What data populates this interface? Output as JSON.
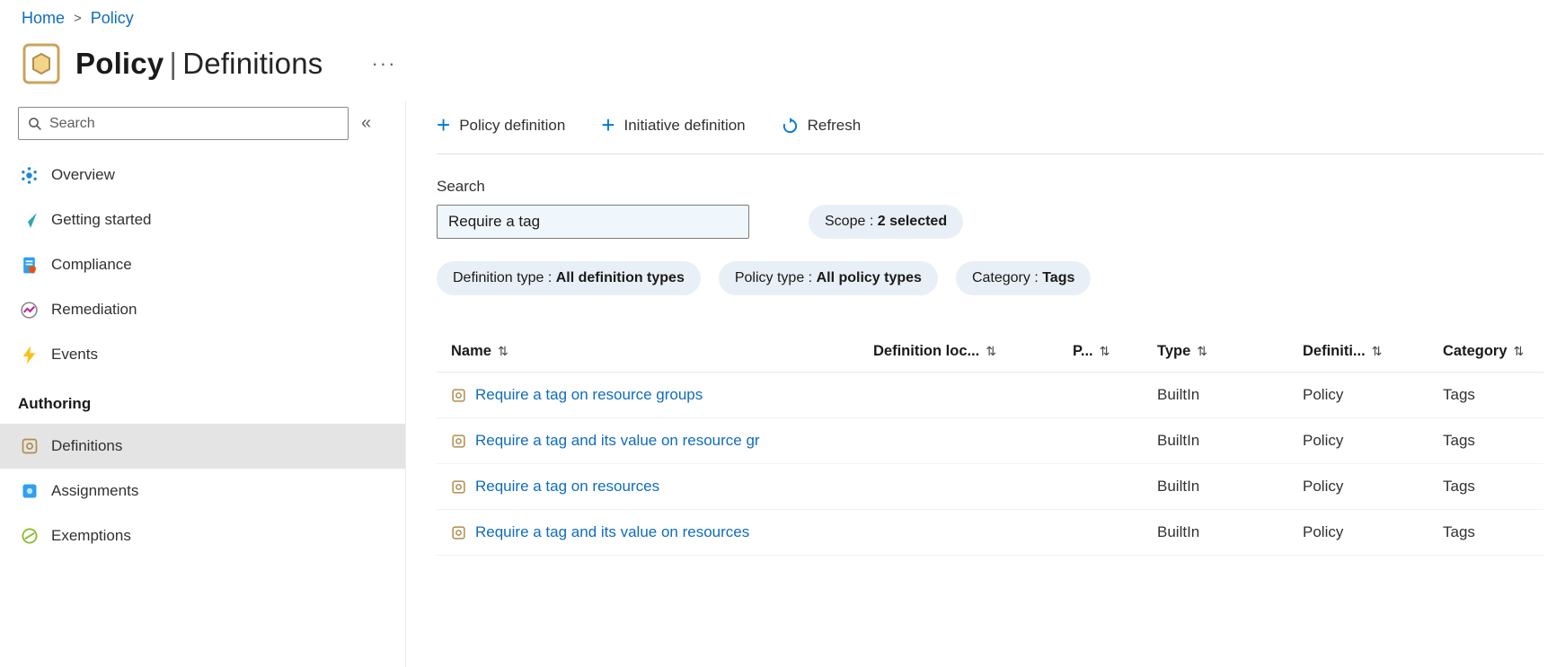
{
  "colors": {
    "accent_blue": "#0078d4",
    "link_blue": "#0f6cbd",
    "pill_background": "#e9eff7",
    "selected_item_background": "#e4e4e4",
    "policy_icon_gold": "#b08d4f"
  },
  "breadcrumb": {
    "separator": ">",
    "items": [
      {
        "label": "Home"
      },
      {
        "label": "Policy"
      }
    ]
  },
  "header": {
    "title_bold": "Policy",
    "title_separator": "|",
    "title_rest": "Definitions",
    "more_label": "···",
    "icon": "policy-page-icon"
  },
  "sidebar": {
    "search": {
      "placeholder": "Search",
      "icon": "search-icon"
    },
    "collapse_icon": "«",
    "items": [
      {
        "label": "Overview",
        "icon": "overview-icon"
      },
      {
        "label": "Getting started",
        "icon": "getting-started-icon"
      },
      {
        "label": "Compliance",
        "icon": "compliance-icon"
      },
      {
        "label": "Remediation",
        "icon": "remediation-icon"
      },
      {
        "label": "Events",
        "icon": "events-icon"
      }
    ],
    "section_label": "Authoring",
    "authoring_items": [
      {
        "label": "Definitions",
        "icon": "definitions-icon",
        "selected": true
      },
      {
        "label": "Assignments",
        "icon": "assignments-icon",
        "selected": false
      },
      {
        "label": "Exemptions",
        "icon": "exemptions-icon",
        "selected": false
      }
    ]
  },
  "command_bar": {
    "policy_definition_label": "Policy definition",
    "initiative_definition_label": "Initiative definition",
    "refresh_label": "Refresh",
    "add_icon": "+",
    "refresh_icon": "refresh-icon"
  },
  "filters": {
    "search_label": "Search",
    "search_value": "Require a tag",
    "pill_separator": " : ",
    "pills": [
      {
        "name": "Scope",
        "value": "2 selected"
      },
      {
        "name": "Definition type",
        "value": "All definition types"
      },
      {
        "name": "Policy type",
        "value": "All policy types"
      },
      {
        "name": "Category",
        "value": "Tags"
      }
    ]
  },
  "table": {
    "sort_icon": "⇅",
    "columns": [
      {
        "label": "Name"
      },
      {
        "label": "Definition loc..."
      },
      {
        "label": "P..."
      },
      {
        "label": "Type"
      },
      {
        "label": "Definiti..."
      },
      {
        "label": "Category"
      }
    ],
    "rows": [
      {
        "name": "Require a tag on resource groups",
        "definition_location": "",
        "p": "",
        "type": "BuiltIn",
        "definition": "Policy",
        "category": "Tags"
      },
      {
        "name": "Require a tag and its value on resource gr",
        "definition_location": "",
        "p": "",
        "type": "BuiltIn",
        "definition": "Policy",
        "category": "Tags"
      },
      {
        "name": "Require a tag on resources",
        "definition_location": "",
        "p": "",
        "type": "BuiltIn",
        "definition": "Policy",
        "category": "Tags"
      },
      {
        "name": "Require a tag and its value on resources",
        "definition_location": "",
        "p": "",
        "type": "BuiltIn",
        "definition": "Policy",
        "category": "Tags"
      }
    ]
  }
}
